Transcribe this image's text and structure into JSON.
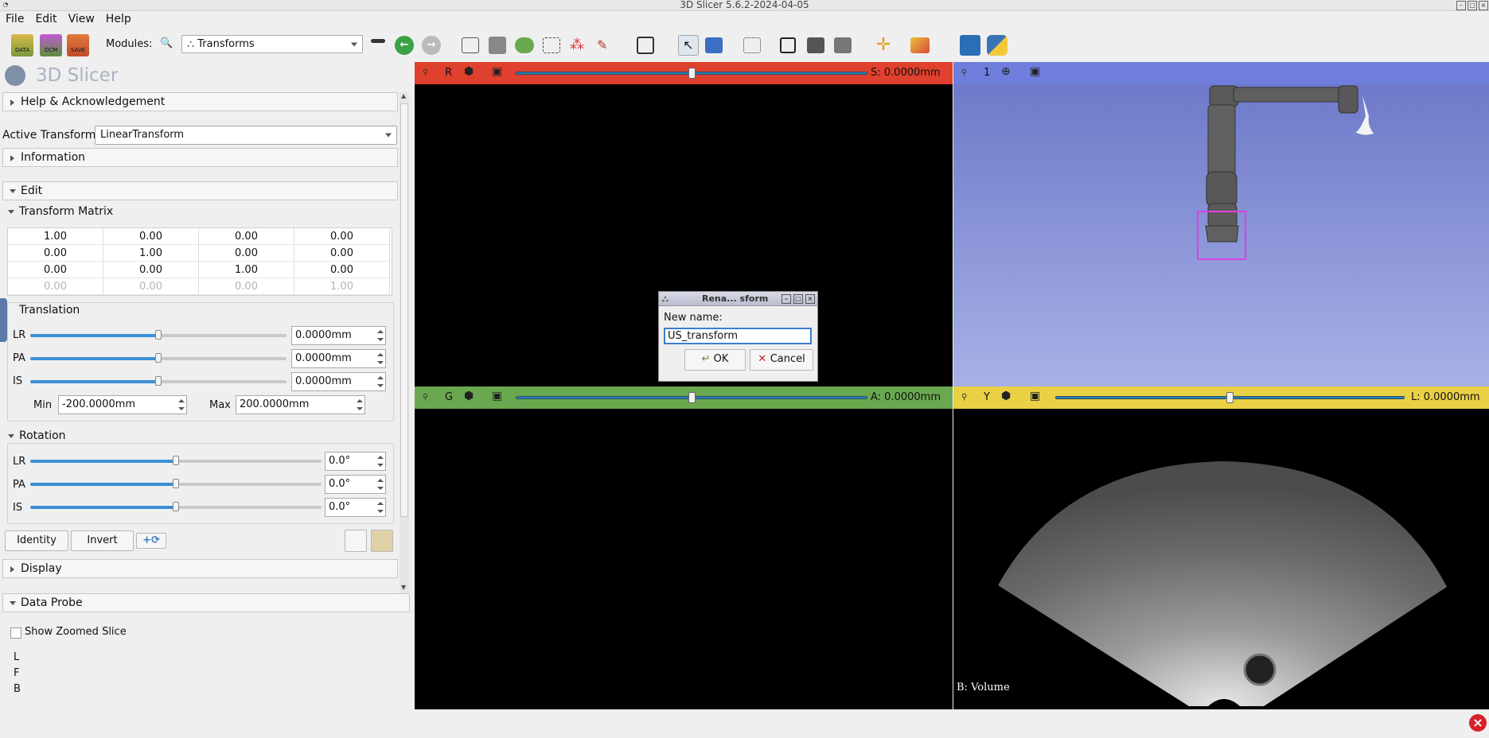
{
  "window": {
    "title": "3D Slicer 5.6.2-2024-04-05"
  },
  "menu": [
    "File",
    "Edit",
    "View",
    "Help"
  ],
  "toolbar": {
    "modules_label": "Modules:",
    "module_selected": "Transforms",
    "load_buttons": [
      "DATA",
      "DCM",
      "SAVE"
    ]
  },
  "panel": {
    "app_name": "3D Slicer",
    "help_section": "Help & Acknowledgement",
    "active_transform_label": "Active Transform:",
    "active_transform_value": "LinearTransform",
    "information_section": "Information",
    "edit_section": "Edit",
    "matrix_section": "Transform Matrix",
    "matrix_rows": [
      [
        "1.00",
        "0.00",
        "0.00",
        "0.00"
      ],
      [
        "0.00",
        "1.00",
        "0.00",
        "0.00"
      ],
      [
        "0.00",
        "0.00",
        "1.00",
        "0.00"
      ],
      [
        "0.00",
        "0.00",
        "0.00",
        "1.00"
      ]
    ],
    "translation": {
      "title": "Translation",
      "rows": [
        {
          "label": "LR",
          "value": "0.0000mm",
          "level": 0.5
        },
        {
          "label": "PA",
          "value": "0.0000mm",
          "level": 0.5
        },
        {
          "label": "IS",
          "value": "0.0000mm",
          "level": 0.5
        }
      ],
      "min_label": "Min",
      "min_value": "-200.0000mm",
      "max_label": "Max",
      "max_value": "200.0000mm"
    },
    "rotation": {
      "title": "Rotation",
      "rows": [
        {
          "label": "LR",
          "value": "0.0°",
          "level": 0.5
        },
        {
          "label": "PA",
          "value": "0.0°",
          "level": 0.5
        },
        {
          "label": "IS",
          "value": "0.0°",
          "level": 0.5
        }
      ]
    },
    "identity_button": "Identity",
    "invert_button": "Invert",
    "display_section": "Display",
    "data_probe_section": "Data Probe",
    "show_zoomed_slice": "Show Zoomed Slice",
    "probe_labels": [
      "L",
      "F",
      "B"
    ]
  },
  "views": {
    "red": {
      "letter": "R",
      "offset": "S: 0.0000mm",
      "color": "#e0402e"
    },
    "threed": {
      "label": "1",
      "color": "#6f7ddc"
    },
    "green": {
      "letter": "G",
      "offset": "A: 0.0000mm",
      "color": "#6aa84f"
    },
    "yellow": {
      "letter": "Y",
      "offset": "L: 0.0000mm",
      "color": "#e9d044",
      "corner_label": "B: Volume"
    }
  },
  "dialog": {
    "title": "Rena... sform",
    "new_name_label": "New name:",
    "input_value": "US_transform",
    "ok_label": "OK",
    "cancel_label": "Cancel"
  }
}
